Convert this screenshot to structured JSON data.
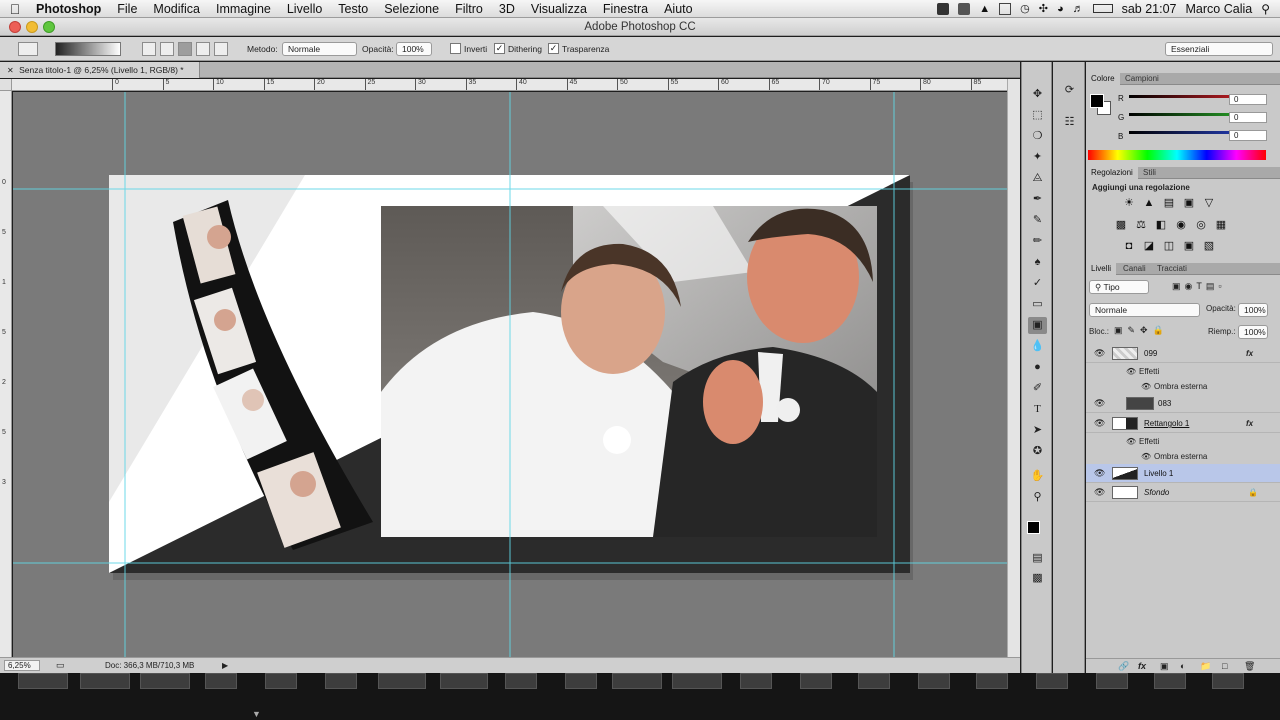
{
  "menubar": {
    "app_name": "Photoshop",
    "items": [
      "File",
      "Modifica",
      "Immagine",
      "Livello",
      "Testo",
      "Selezione",
      "Filtro",
      "3D",
      "Visualizza",
      "Finestra",
      "Aiuto"
    ],
    "clock": "sab 21:07",
    "user": "Marco Calia"
  },
  "window": {
    "title": "Adobe Photoshop CC"
  },
  "options_bar": {
    "metodo_label": "Metodo:",
    "metodo_value": "Normale",
    "opacita_label": "Opacità:",
    "opacita_value": "100%",
    "inverti_label": "Inverti",
    "dithering_label": "Dithering",
    "trasparenza_label": "Trasparenza",
    "workspace": "Essenziali"
  },
  "document": {
    "tab_title": "Senza titolo-1 @ 6,25% (Livello 1, RGB/8) *",
    "zoom": "6,25%",
    "doc_info": "Doc: 366,3 MB/710,3 MB"
  },
  "rulers": {
    "h_labels": [
      "0",
      "5",
      "10",
      "15",
      "20",
      "25",
      "30",
      "35",
      "40",
      "45",
      "50",
      "55",
      "60",
      "65",
      "70",
      "75",
      "80",
      "85",
      "90"
    ],
    "v_labels": [
      "0",
      "5",
      "1",
      "5",
      "2",
      "5",
      "3"
    ]
  },
  "color_panel": {
    "tabs": [
      "Colore",
      "Campioni"
    ],
    "channels": [
      {
        "label": "R",
        "value": "0",
        "color": "#e8242c"
      },
      {
        "label": "G",
        "value": "0",
        "color": "#2fbf2f"
      },
      {
        "label": "B",
        "value": "0",
        "color": "#2a48d8"
      }
    ]
  },
  "adjustments_panel": {
    "tabs": [
      "Regolazioni",
      "Stili"
    ],
    "heading": "Aggiungi una regolazione"
  },
  "layers_panel": {
    "tabs": [
      "Livelli",
      "Canali",
      "Tracciati"
    ],
    "filter_value": "Tipo",
    "blend_value": "Normale",
    "opacity_label": "Opacità:",
    "opacity_value": "100%",
    "lock_label": "Bloc.:",
    "fill_label": "Riemp.:",
    "fill_value": "100%",
    "layers": [
      {
        "name": "099",
        "fx": "fx"
      },
      {
        "name": "Effetti"
      },
      {
        "name": "Ombra esterna"
      },
      {
        "name": "083"
      },
      {
        "name": "Rettangolo 1",
        "fx": "fx"
      },
      {
        "name": "Effetti"
      },
      {
        "name": "Ombra esterna"
      },
      {
        "name": "Livello 1"
      },
      {
        "name": "Sfondo"
      }
    ]
  },
  "theme": {
    "accent_selected": "#b9c7e9",
    "guide_color": "#5fd6e6"
  }
}
